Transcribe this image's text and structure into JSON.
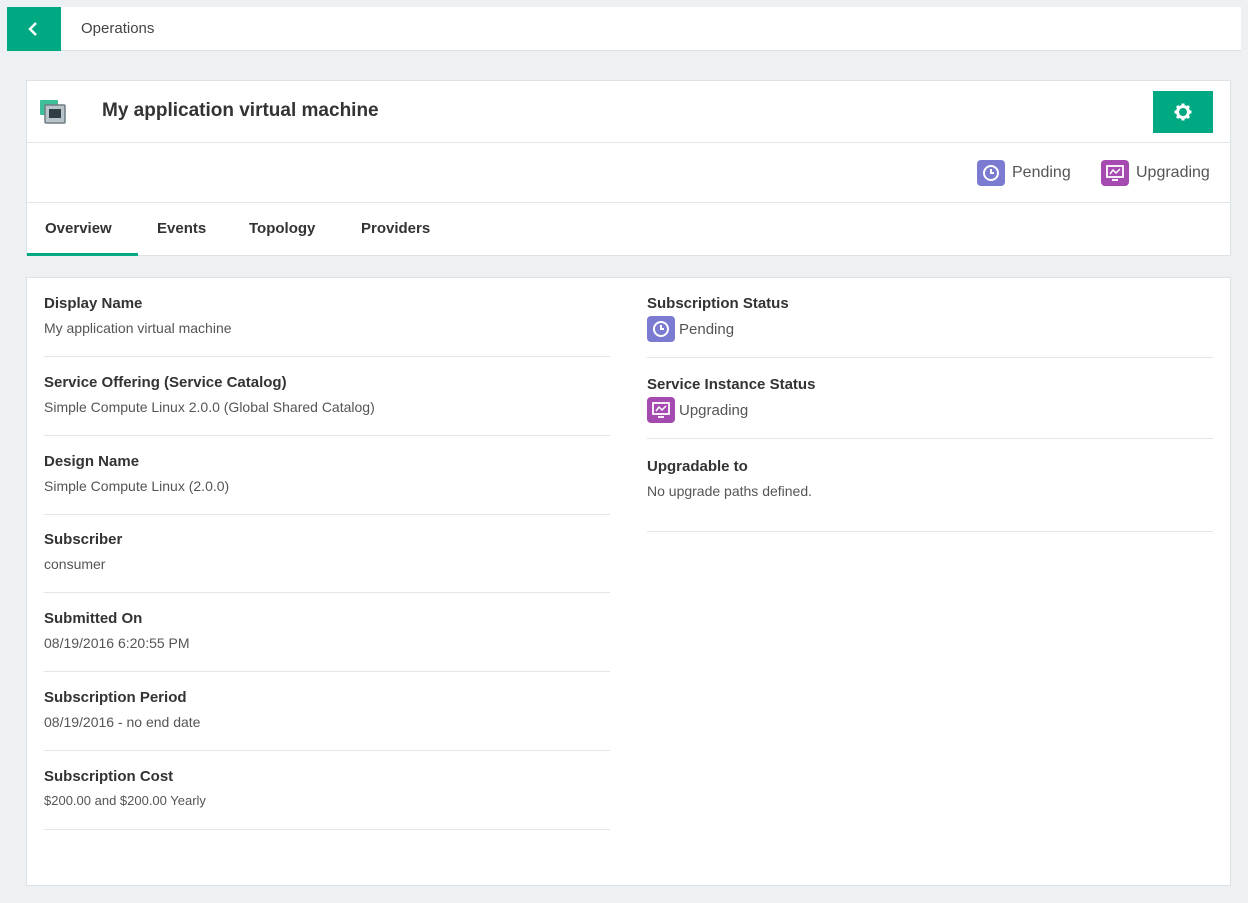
{
  "topbar": {
    "breadcrumb": "Operations",
    "back_icon": "chevron-left-icon"
  },
  "header": {
    "title": "My application virtual machine",
    "icon": "vm-icon",
    "settings_icon": "gear-icon",
    "accent_color": "#01a982"
  },
  "statuses": {
    "pending": {
      "label": "Pending",
      "icon": "clock-icon",
      "color": "#7a7bd1"
    },
    "upgrading": {
      "label": "Upgrading",
      "icon": "monitor-icon",
      "color": "#a44ab0"
    }
  },
  "tabs": [
    {
      "label": "Overview",
      "active": true
    },
    {
      "label": "Events"
    },
    {
      "label": "Topology"
    },
    {
      "label": "Providers"
    }
  ],
  "details": {
    "left": [
      {
        "label": "Display Name",
        "value": "My application virtual machine"
      },
      {
        "label": "Service Offering (Service Catalog)",
        "value": "Simple Compute Linux 2.0.0 (Global Shared Catalog)"
      },
      {
        "label": "Design Name",
        "value": "Simple Compute Linux (2.0.0)"
      },
      {
        "label": "Subscriber",
        "value": "consumer"
      },
      {
        "label": "Submitted On",
        "value": "08/19/2016 6:20:55 PM"
      },
      {
        "label": "Subscription Period",
        "value": "08/19/2016 - no end date"
      },
      {
        "label": "Subscription Cost",
        "value": "$200.00 and $200.00 Yearly"
      }
    ],
    "right": [
      {
        "label": "Subscription Status",
        "value": "Pending"
      },
      {
        "label": "Service Instance Status",
        "value": "Upgrading"
      },
      {
        "label": "Upgradable to",
        "value": "No upgrade paths defined."
      }
    ]
  }
}
